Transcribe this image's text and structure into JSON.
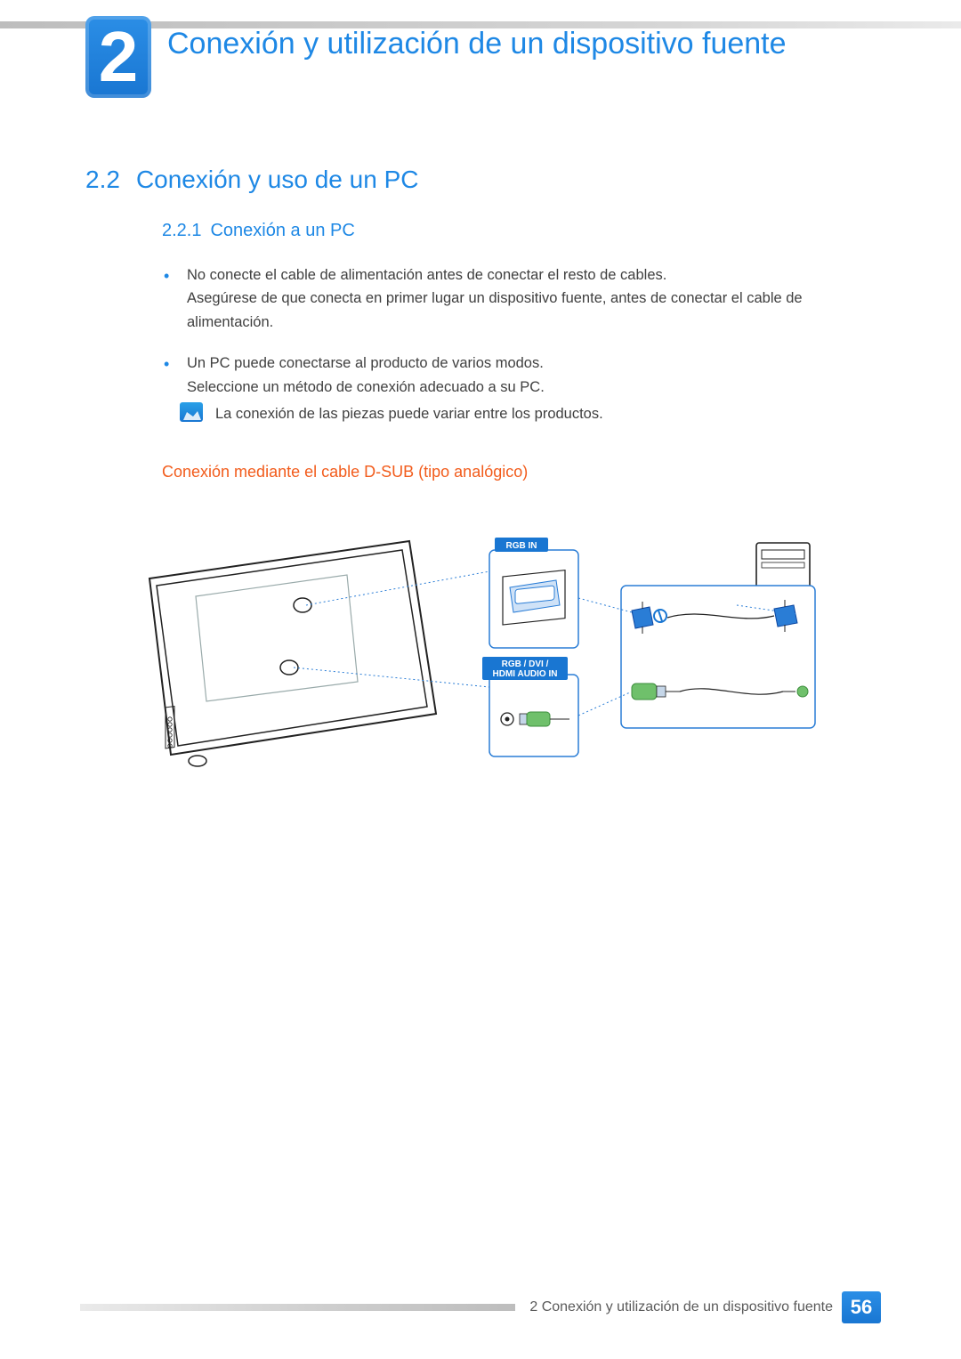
{
  "chapter": {
    "number": "2",
    "title": "Conexión y utilización de un dispositivo fuente"
  },
  "section": {
    "number": "2.2",
    "title": "Conexión y uso de un PC"
  },
  "subsection": {
    "number": "2.2.1",
    "title": "Conexión a un PC"
  },
  "bullets": [
    {
      "line1": "No conecte el cable de alimentación antes de conectar el resto de cables.",
      "line2": "Asegúrese de que conecta en primer lugar un dispositivo fuente, antes de conectar el cable de alimentación."
    },
    {
      "line1": "Un PC puede conectarse al producto de varios modos.",
      "line2": "Seleccione un método de conexión adecuado a su PC."
    }
  ],
  "note": "La conexión de las piezas puede variar entre los productos.",
  "h4": "Conexión mediante el cable D-SUB (tipo analógico)",
  "diagram": {
    "callout1": "RGB IN",
    "callout2_line1": "RGB / DVI /",
    "callout2_line2": "HDMI AUDIO IN"
  },
  "footer": {
    "text": "2 Conexión y utilización de un dispositivo fuente",
    "page": "56"
  }
}
